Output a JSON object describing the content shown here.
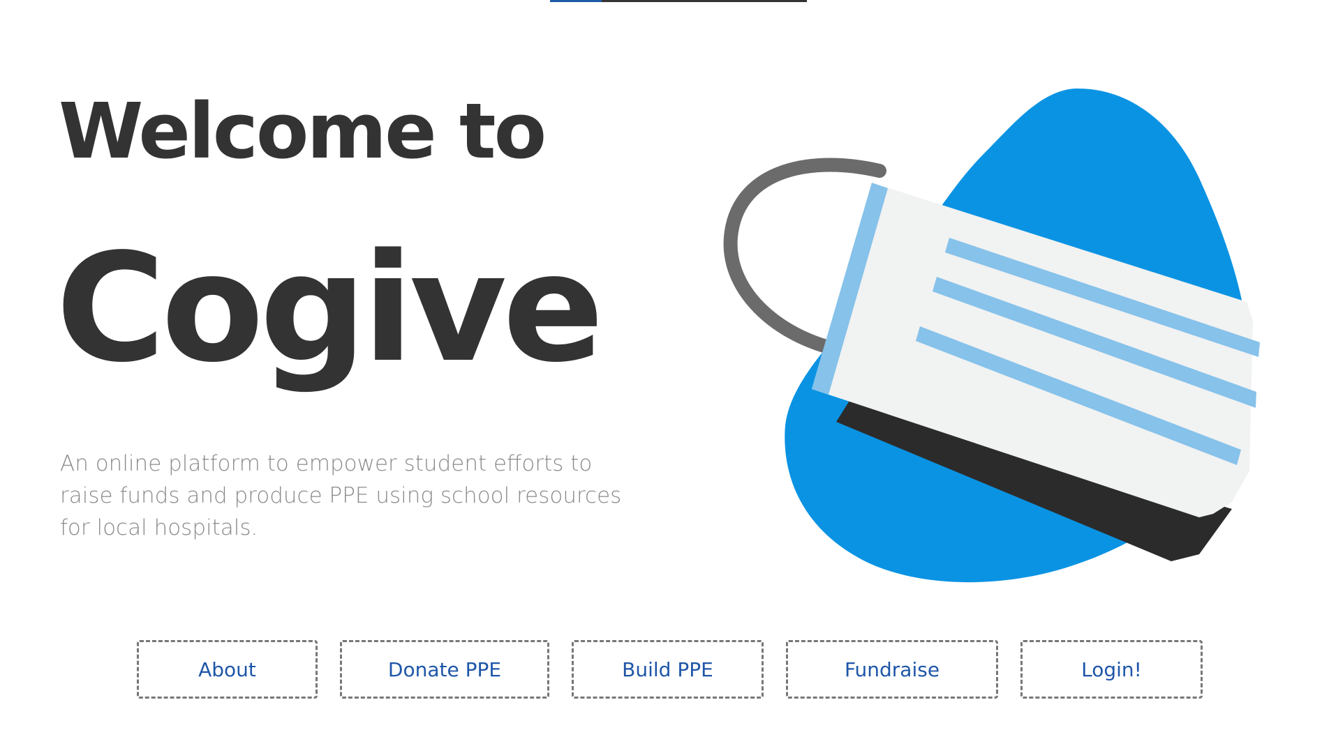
{
  "hero": {
    "title_line1": "Welcome to",
    "title_line2": "Cogive",
    "description": "An online platform to empower student efforts to raise funds and produce PPE using school resources for local hospitals."
  },
  "nav": {
    "about": "About",
    "donate": "Donate PPE",
    "build": "Build PPE",
    "fundraise": "Fundraise",
    "login": "Login!"
  },
  "top_progress": {
    "fraction": 0.2
  },
  "colors": {
    "text_dark": "#333333",
    "text_muted": "#8a8a8a",
    "link_blue": "#1e56a8",
    "blob_blue": "#0b93e3",
    "mask_white": "#f1f2f2",
    "mask_stripe": "#86c2ea",
    "mask_dark": "#2b2b2b",
    "strap_gray": "#6b6b6b",
    "border_dashed": "#777777"
  },
  "icons": {
    "illustration": "face-mask-illustration"
  }
}
